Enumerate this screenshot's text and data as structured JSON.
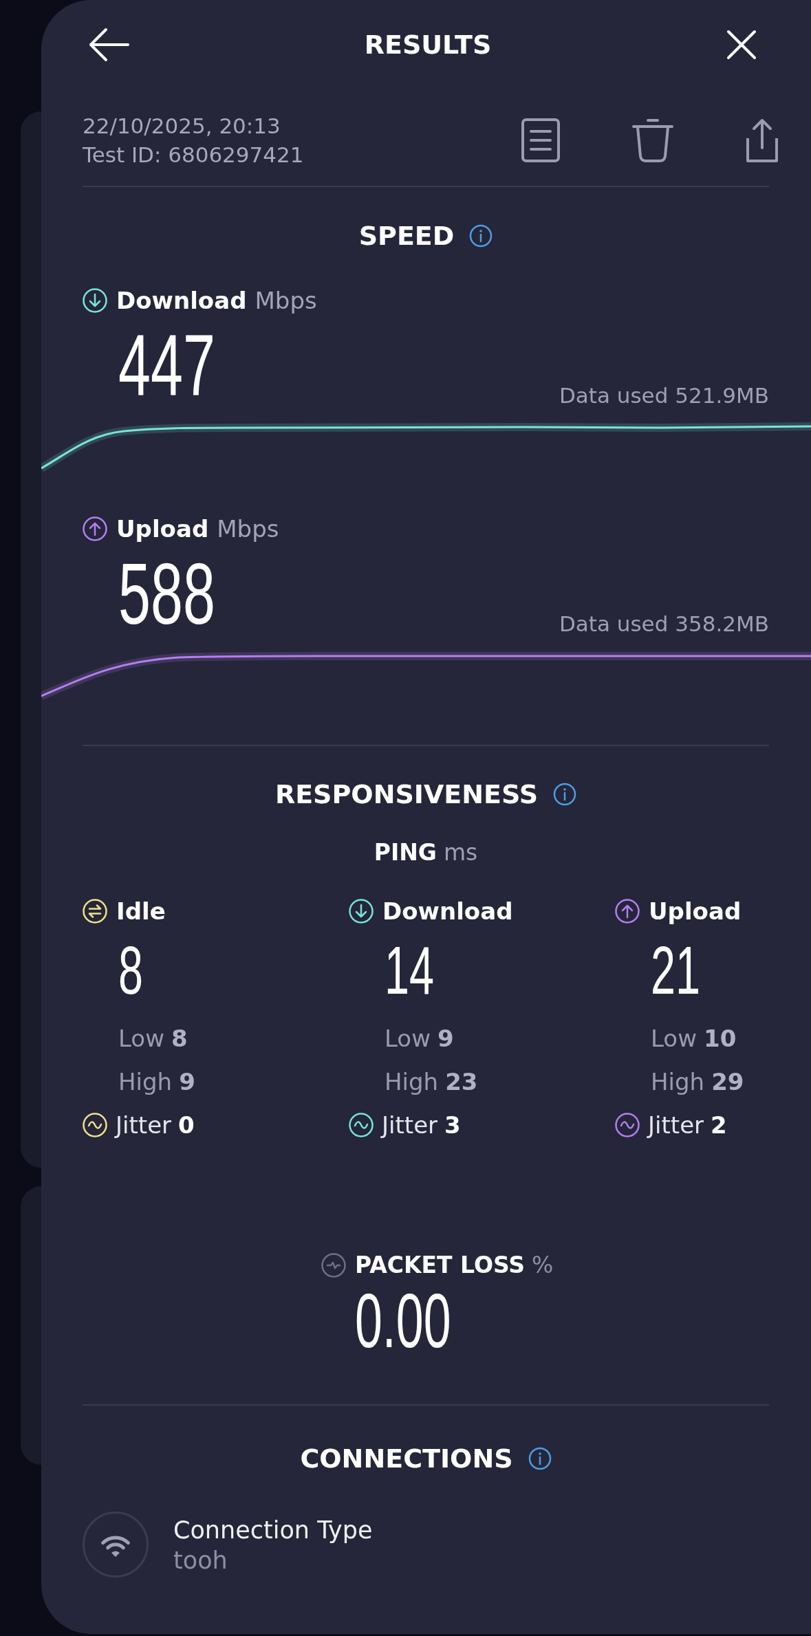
{
  "header": {
    "title": "RESULTS"
  },
  "test": {
    "date_time": "22/10/2025, 20:13",
    "test_id": "Test ID: 6806297421"
  },
  "speed": {
    "title": "SPEED",
    "results": [
      {
        "kind": "download",
        "label": "Download",
        "unit": "Mbps",
        "value": "447",
        "data_used": "Data used 521.9MB",
        "color": "#76e6d8"
      },
      {
        "kind": "upload",
        "label": "Upload",
        "unit": "Mbps",
        "value": "588",
        "data_used": "Data used 358.2MB",
        "color": "#b57df2"
      }
    ]
  },
  "responsiveness": {
    "title": "RESPONSIVENESS",
    "ping": {
      "label": "PING",
      "unit": "ms"
    },
    "columns": [
      {
        "kind": "idle",
        "label": "Idle",
        "value": "8",
        "low_label": "Low",
        "low": "8",
        "high_label": "High",
        "high": "9",
        "jitter_label": "Jitter",
        "jitter": "0",
        "color": "#f2df8c"
      },
      {
        "kind": "download",
        "label": "Download",
        "value": "14",
        "low_label": "Low",
        "low": "9",
        "high_label": "High",
        "high": "23",
        "jitter_label": "Jitter",
        "jitter": "3",
        "color": "#76e6d8"
      },
      {
        "kind": "upload",
        "label": "Upload",
        "value": "21",
        "low_label": "Low",
        "low": "10",
        "high_label": "High",
        "high": "29",
        "jitter_label": "Jitter",
        "jitter": "2",
        "color": "#b57df2"
      }
    ]
  },
  "packet_loss": {
    "label": "PACKET LOSS",
    "unit": "%",
    "value": "0.00"
  },
  "connections": {
    "title": "CONNECTIONS",
    "items": [
      {
        "kind": "wifi",
        "label": "Connection Type",
        "value": "tooh"
      }
    ]
  }
}
